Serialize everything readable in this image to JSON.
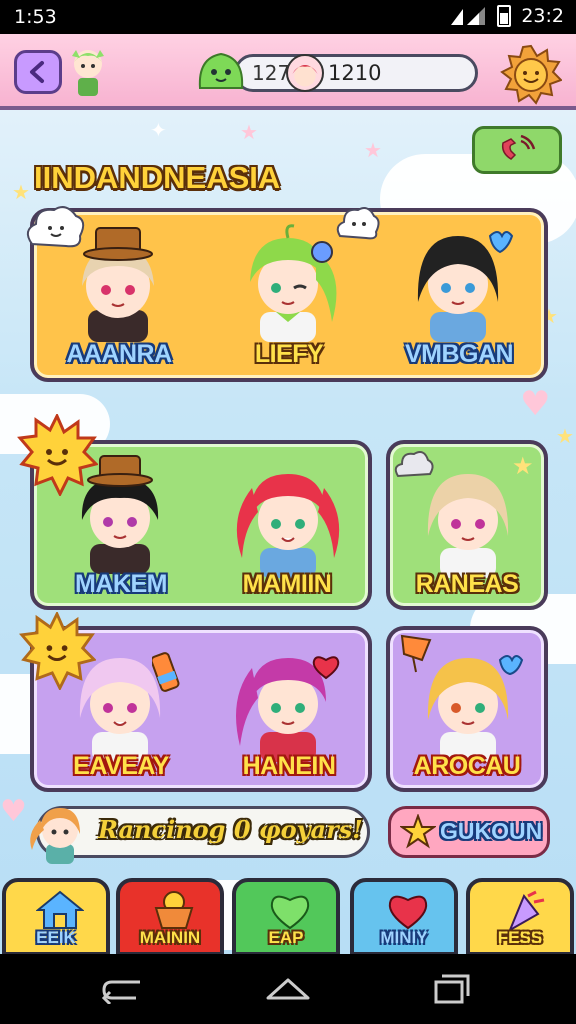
{
  "status_bar": {
    "time_left": "1:53",
    "time_right": "23:2"
  },
  "top_bar": {
    "currency_a": "127",
    "currency_b": "1210"
  },
  "section_title": "IINDANDNEASIA",
  "rows": [
    {
      "characters": [
        {
          "name": "AAANRA",
          "name_style": "blue"
        },
        {
          "name": "LIEFY",
          "name_style": "yellow"
        },
        {
          "name": "VMBGAN",
          "name_style": "blue"
        }
      ]
    },
    {
      "characters": [
        {
          "name": "MAKEM",
          "name_style": "blue"
        },
        {
          "name": "MAMIIN",
          "name_style": "yellow"
        },
        {
          "name": "RANEAS",
          "name_style": "yellow"
        }
      ]
    },
    {
      "characters": [
        {
          "name": "EAVEAY",
          "name_style": "red"
        },
        {
          "name": "HANEIN",
          "name_style": "red"
        },
        {
          "name": "AROCAU",
          "name_style": "red"
        }
      ]
    }
  ],
  "ticker": {
    "text": "Rancinog 0 φoyars!"
  },
  "action_button": {
    "label": "GUKOUN"
  },
  "bottom_nav": [
    {
      "label": "EEIK",
      "color": "#ffd84a"
    },
    {
      "label": "MAININ",
      "color": "#e8322a"
    },
    {
      "label": "EAP",
      "color": "#52c85a"
    },
    {
      "label": "MINIY",
      "color": "#66c3ee"
    },
    {
      "label": "FESS",
      "color": "#ffd84a"
    }
  ],
  "colors": {
    "title_fill": "#ffd23a",
    "card_orange": "#ffc34a",
    "card_green": "#9fe07a",
    "card_purple": "#c6a1ef"
  }
}
